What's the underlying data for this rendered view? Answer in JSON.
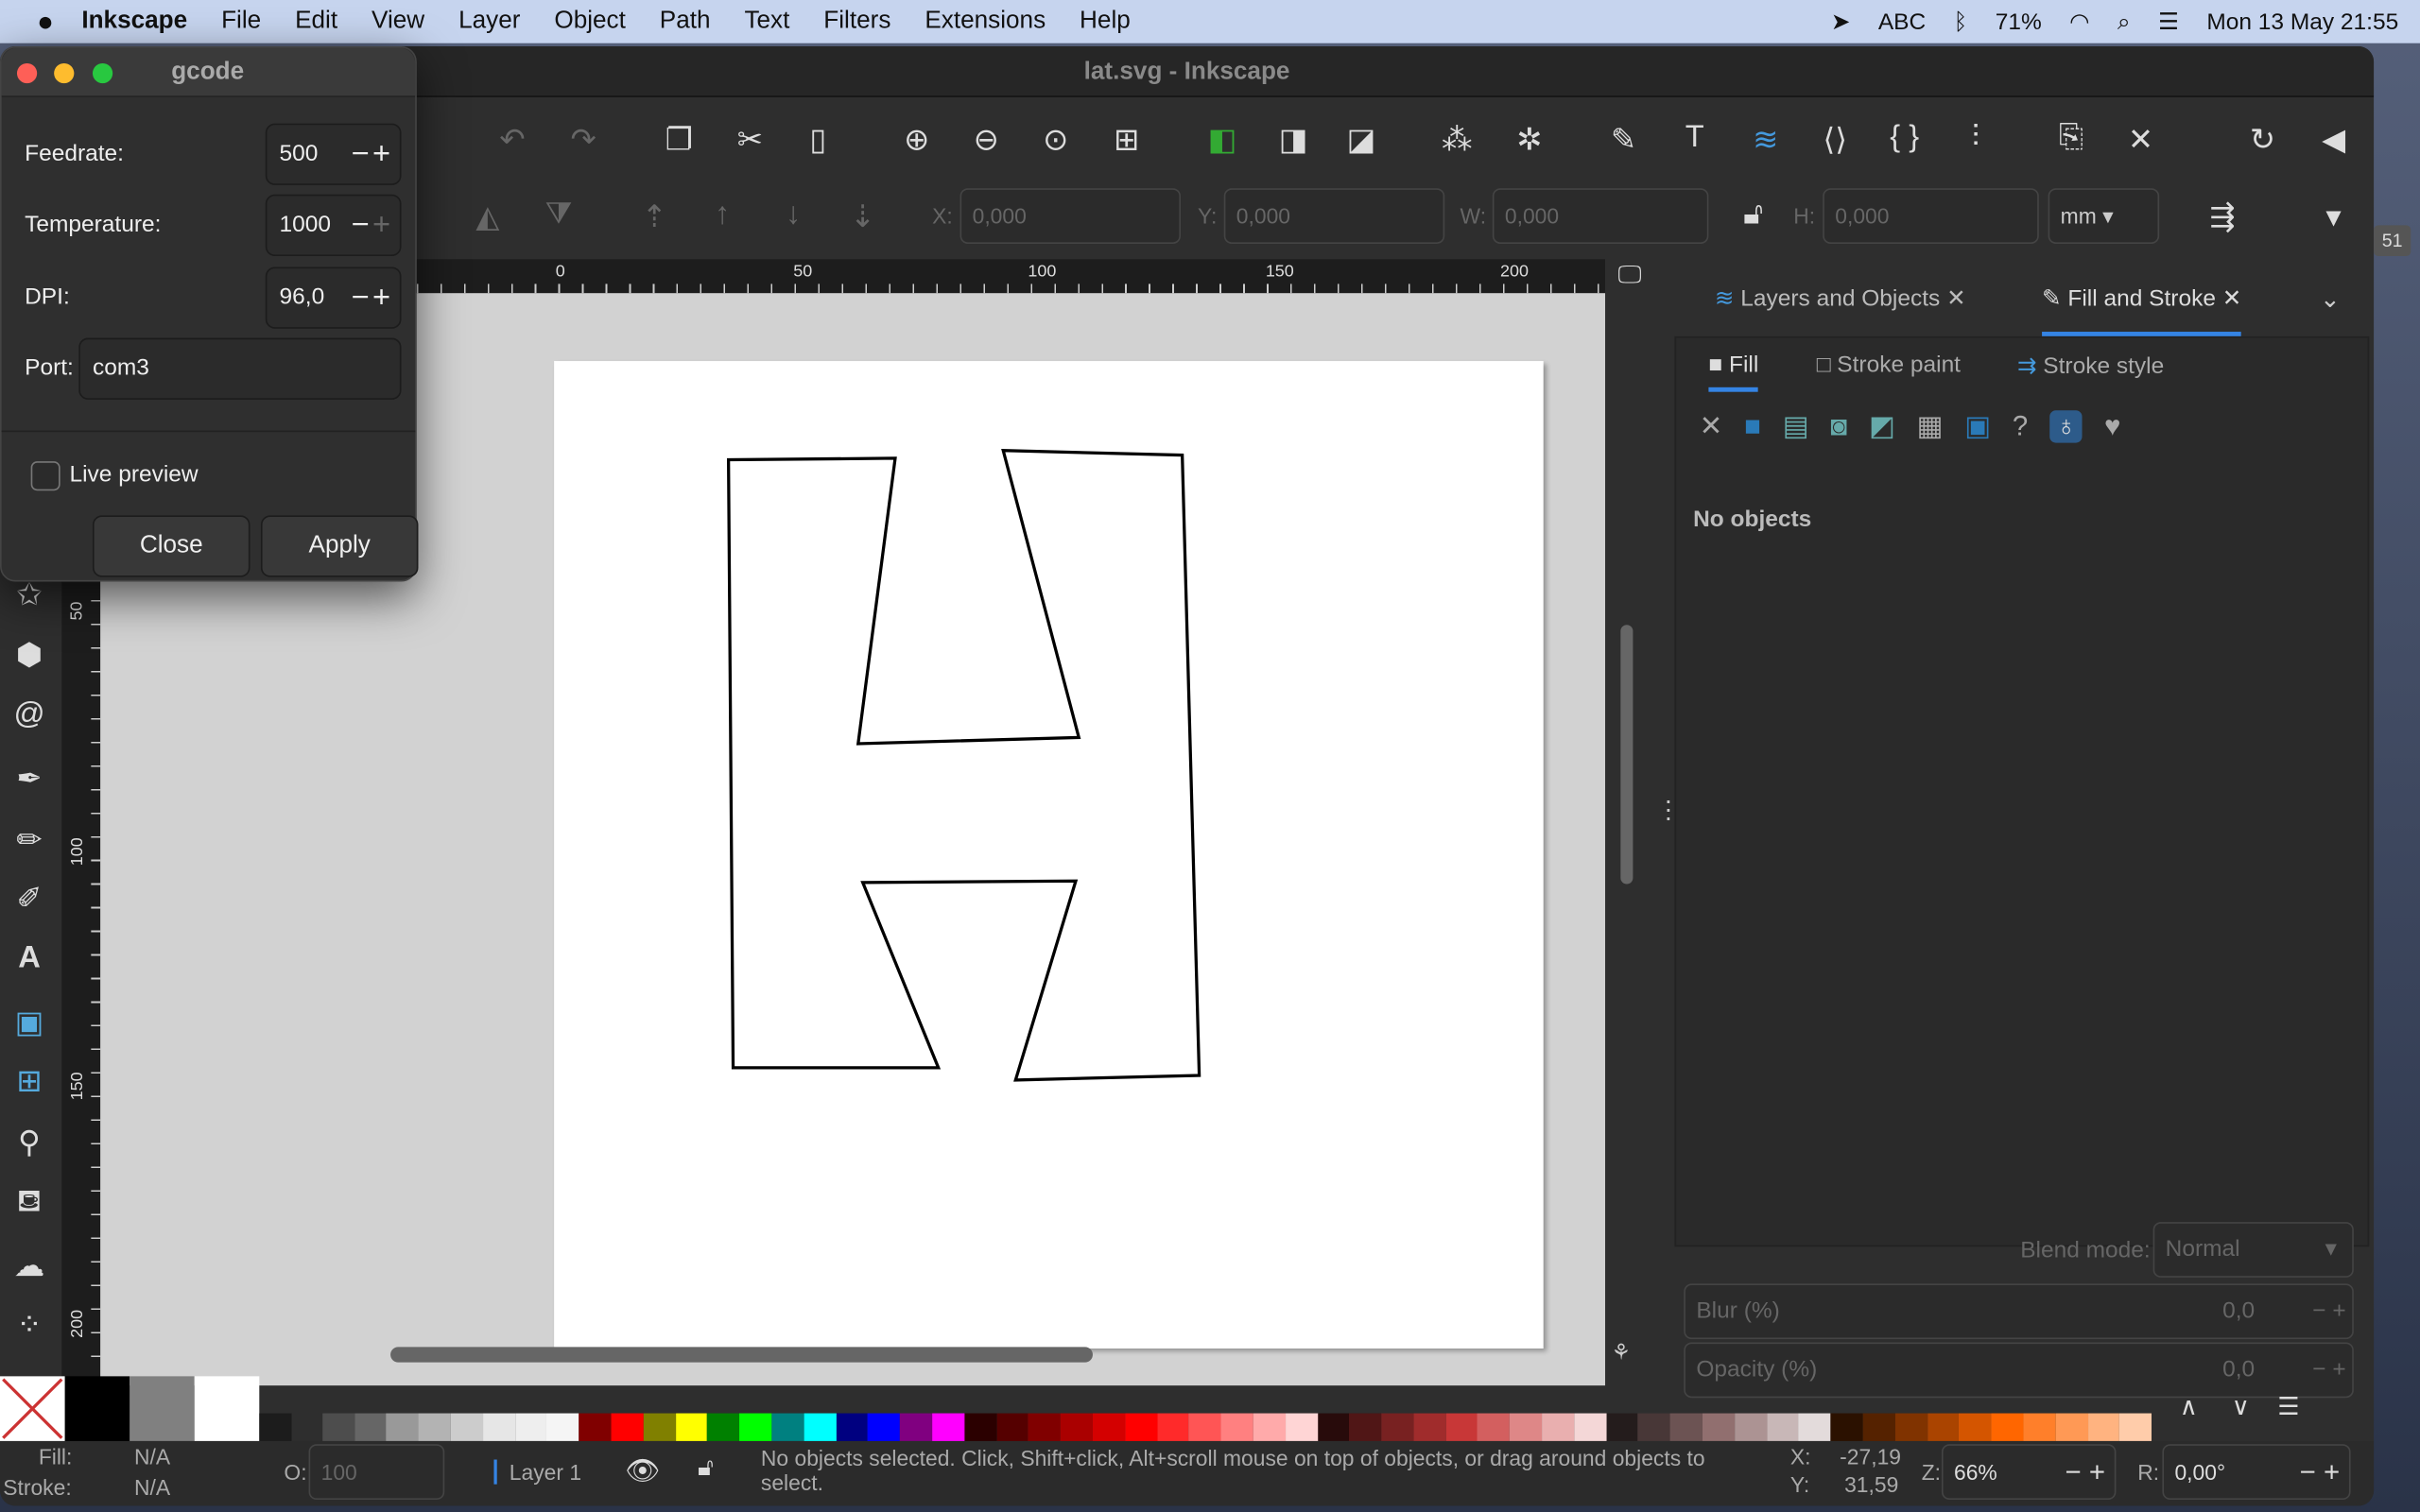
{
  "menubar": {
    "app": "Inkscape",
    "items": [
      "File",
      "Edit",
      "View",
      "Layer",
      "Object",
      "Path",
      "Text",
      "Filters",
      "Extensions",
      "Help"
    ],
    "input_source": "ABC",
    "battery": "71%",
    "datetime": "Mon 13 May  21:55"
  },
  "window": {
    "title": "lat.svg - Inkscape"
  },
  "toolbar": {
    "x_label": "X:",
    "x": "0,000",
    "y_label": "Y:",
    "y": "0,000",
    "w_label": "W:",
    "w": "0,000",
    "h_label": "H:",
    "h": "0,000",
    "unit": "mm"
  },
  "ruler": {
    "ticks": [
      "0",
      "50",
      "100",
      "150",
      "200"
    ],
    "vticks": [
      "50",
      "100",
      "150",
      "200"
    ]
  },
  "dialog": {
    "title": "gcode",
    "feedrate_label": "Feedrate:",
    "feedrate": "500",
    "temperature_label": "Temperature:",
    "temperature": "1000",
    "dpi_label": "DPI:",
    "dpi": "96,0",
    "port_label": "Port:",
    "port": "com3",
    "live_preview": "Live preview",
    "live_preview_checked": false,
    "close": "Close",
    "apply": "Apply"
  },
  "panel": {
    "tabs": [
      "Layers and Objects",
      "Fill and Stroke"
    ],
    "active_tab": "Fill and Stroke",
    "subtabs": [
      "Fill",
      "Stroke paint",
      "Stroke style"
    ],
    "no_objects": "No objects",
    "blend_label": "Blend mode:",
    "blend": "Normal",
    "blur_label": "Blur (%)",
    "blur": "0,0",
    "opacity_label": "Opacity (%)",
    "opacity": "0,0"
  },
  "palette": [
    "#1c1c1c",
    "#2e2e2e",
    "#4d4d4d",
    "#666666",
    "#999999",
    "#b3b3b3",
    "#cccccc",
    "#e6e6e6",
    "#eeeeee",
    "#f5f5f5",
    "#800000",
    "#ff0000",
    "#808000",
    "#ffff00",
    "#008000",
    "#00ff00",
    "#008080",
    "#00ffff",
    "#000080",
    "#0000ff",
    "#800080",
    "#ff00ff",
    "#2b0000",
    "#550000",
    "#800000",
    "#aa0000",
    "#d40000",
    "#ff0000",
    "#ff2a2a",
    "#ff5555",
    "#ff8080",
    "#ffaaaa",
    "#ffd5d5",
    "#280b0b",
    "#501616",
    "#782121",
    "#a02c2c",
    "#c83737",
    "#d35f5f",
    "#de8787",
    "#e9afaf",
    "#f4d7d7",
    "#241c1c",
    "#483737",
    "#6c5353",
    "#916f6f",
    "#ac9393",
    "#c8b7b7",
    "#e3dbdb",
    "#2b1100",
    "#552200",
    "#803300",
    "#aa4400",
    "#d45500",
    "#ff6600",
    "#ff7f2a",
    "#ff9955",
    "#ffb380",
    "#ffccaa"
  ],
  "status": {
    "fill_label": "Fill:",
    "fill": "N/A",
    "stroke_label": "Stroke:",
    "stroke": "N/A",
    "opacity_label": "O:",
    "opacity": "100",
    "layer": "Layer 1",
    "message": "No objects selected. Click, Shift+click, Alt+scroll mouse on top of objects, or drag around objects to select.",
    "x_label": "X:",
    "x": "-27,19",
    "y_label": "Y:",
    "y": "31,59",
    "zoom_label": "Z:",
    "zoom": "66%",
    "rotation_label": "R:",
    "rotation": "0,00°"
  },
  "badge": "51"
}
